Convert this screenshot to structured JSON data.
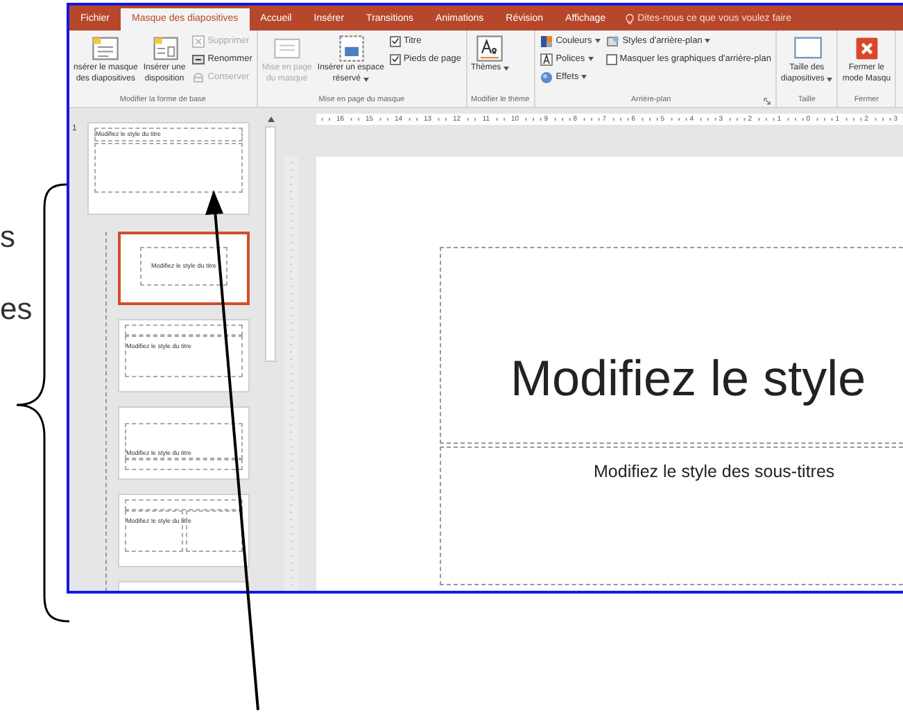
{
  "annotation": {
    "texts": [
      "s",
      "es"
    ]
  },
  "ribbon": {
    "tabs": [
      {
        "label": "Fichier",
        "selected": false
      },
      {
        "label": "Masque des diapositives",
        "selected": true
      },
      {
        "label": "Accueil",
        "selected": false
      },
      {
        "label": "Insérer",
        "selected": false
      },
      {
        "label": "Transitions",
        "selected": false
      },
      {
        "label": "Animations",
        "selected": false
      },
      {
        "label": "Révision",
        "selected": false
      },
      {
        "label": "Affichage",
        "selected": false
      }
    ],
    "tell_me": "Dites-nous ce que vous voulez faire",
    "groups": [
      {
        "label": "Modifier la forme de base",
        "columns": [
          [
            {
              "kind": "large",
              "lines": [
                "nsérer le masque",
                "des diapositives"
              ],
              "disabled": false
            }
          ],
          [
            {
              "kind": "large",
              "lines": [
                "Insérer une",
                "disposition"
              ],
              "disabled": false
            }
          ],
          [
            {
              "kind": "small",
              "label": "Supprimer",
              "disabled": true
            },
            {
              "kind": "small",
              "label": "Renommer",
              "disabled": false
            },
            {
              "kind": "small",
              "label": "Conserver",
              "disabled": true
            }
          ]
        ]
      },
      {
        "label": "Mise en page du masque",
        "columns": [
          [
            {
              "kind": "large",
              "lines": [
                "Mise en page",
                "du masque"
              ],
              "disabled": true
            }
          ],
          [
            {
              "kind": "large",
              "lines": [
                "Insérer un espace",
                "réservé"
              ],
              "dropdown": true,
              "disabled": false
            }
          ],
          [
            {
              "kind": "check",
              "label": "Titre",
              "checked": true
            },
            {
              "kind": "check",
              "label": "Pieds de page",
              "checked": true
            }
          ]
        ]
      },
      {
        "label": "Modifier le thème",
        "columns": [
          [
            {
              "kind": "large",
              "lines": [
                "Thèmes"
              ],
              "dropdown": true
            }
          ]
        ]
      },
      {
        "label": "Arrière-plan",
        "launcher": true,
        "columns": [
          [
            {
              "kind": "small",
              "label": "Couleurs",
              "dropdown": true
            },
            {
              "kind": "small",
              "label": "Polices",
              "dropdown": true
            },
            {
              "kind": "small",
              "label": "Effets",
              "dropdown": true
            }
          ],
          [
            {
              "kind": "small",
              "label": "Styles d'arrière-plan",
              "dropdown": true
            },
            {
              "kind": "check",
              "label": "Masquer les graphiques d'arrière-plan",
              "checked": false
            }
          ]
        ]
      },
      {
        "label": "Taille",
        "columns": [
          [
            {
              "kind": "large",
              "lines": [
                "Taille des",
                "diapositives"
              ],
              "dropdown": true
            }
          ]
        ]
      },
      {
        "label": "Fermer",
        "columns": [
          [
            {
              "kind": "large",
              "lines": [
                "Fermer le",
                "mode Masqu"
              ]
            }
          ]
        ]
      }
    ]
  },
  "h_ruler": [
    "16",
    "15",
    "14",
    "13",
    "12",
    "11",
    "10",
    "9",
    "8",
    "7",
    "6",
    "5",
    "4",
    "3",
    "2",
    "1",
    "0",
    "1",
    "2",
    "3"
  ],
  "slides": [
    {
      "kind": "master",
      "number": "1",
      "title": "Modifiez le style du titre",
      "selected": false
    },
    {
      "kind": "title",
      "title": "Modifiez le style du titre",
      "selected": true
    },
    {
      "kind": "content",
      "title": "Modifiez le style du titre",
      "selected": false
    },
    {
      "kind": "section",
      "title": "Modifiez le style du titre",
      "selected": false
    },
    {
      "kind": "two",
      "title": "Modifiez le style du titre",
      "selected": false
    },
    {
      "kind": "blank",
      "selected": false
    }
  ],
  "editor": {
    "title": "Modifiez le style",
    "subtitle": "Modifiez le style des sous-titres"
  }
}
